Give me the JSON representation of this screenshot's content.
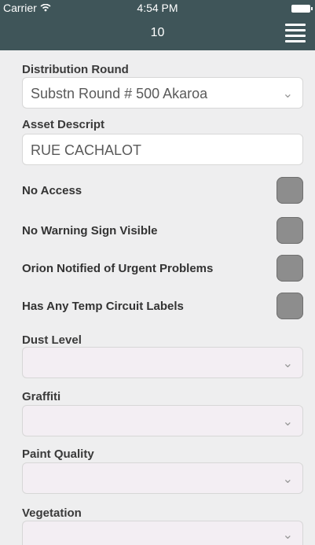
{
  "status": {
    "carrier": "Carrier",
    "time": "4:54 PM"
  },
  "header": {
    "title": "10"
  },
  "form": {
    "distribution_round_label": "Distribution Round",
    "distribution_round_value": "Substn Round #  500 Akaroa",
    "asset_descript_label": "Asset Descript",
    "asset_descript_value": "RUE CACHALOT",
    "checkboxes": [
      {
        "label": "No Access",
        "checked": false
      },
      {
        "label": "No Warning Sign Visible",
        "checked": false
      },
      {
        "label": "Orion Notified of Urgent Problems",
        "checked": false
      },
      {
        "label": "Has Any Temp Circuit Labels",
        "checked": false
      }
    ],
    "dust_level_label": "Dust Level",
    "graffiti_label": "Graffiti",
    "paint_quality_label": "Paint Quality",
    "vegetation_label": "Vegetation"
  }
}
